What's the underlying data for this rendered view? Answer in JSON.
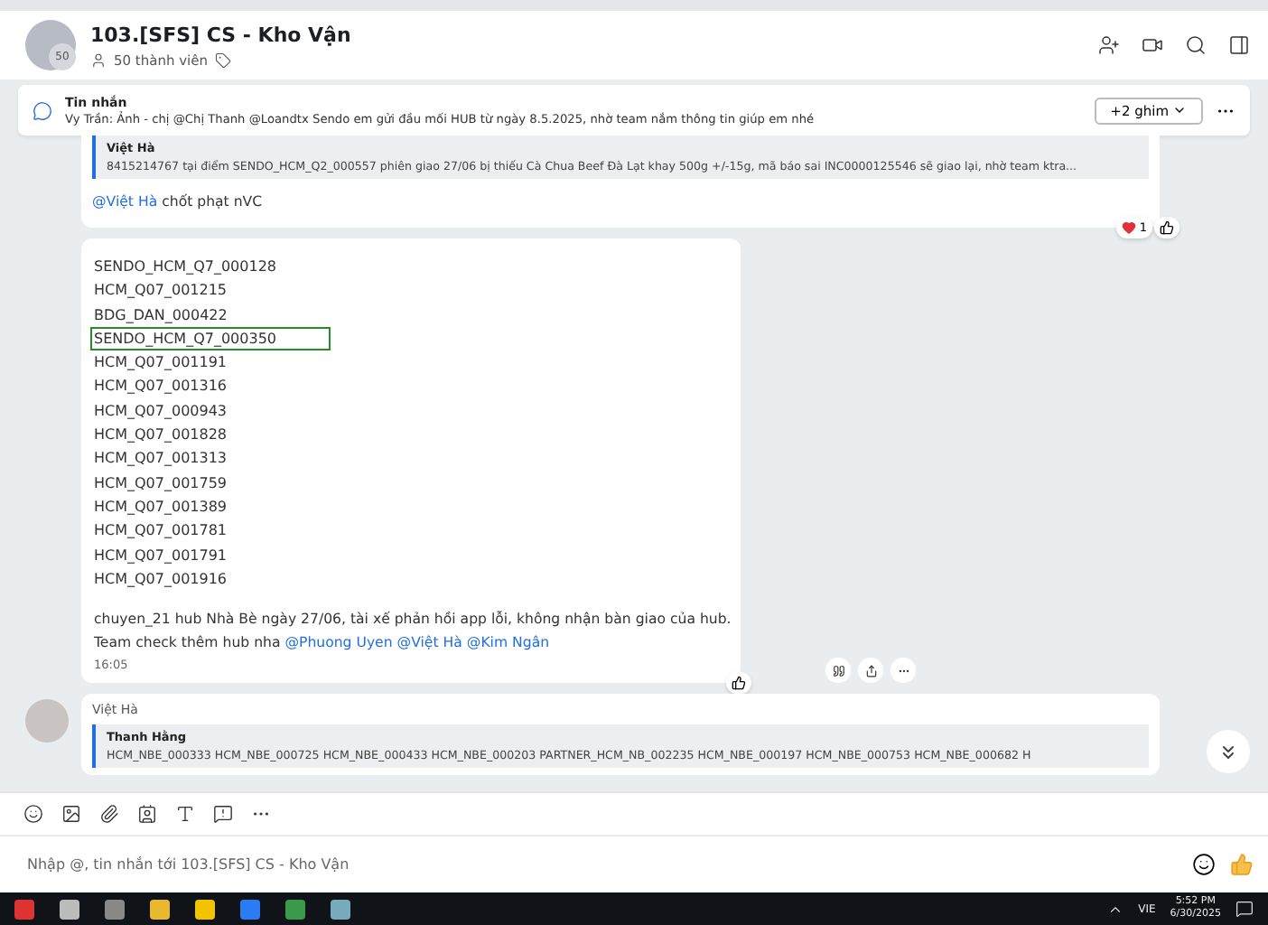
{
  "header": {
    "title": "103.[SFS] CS - Kho Vận",
    "members": "50 thành viên",
    "avatar_count": "50"
  },
  "pinned": {
    "label": "Tin nhắn",
    "sender": "Vy Trần:",
    "text": "Ảnh - chị @Chị Thanh @Loandtx Sendo em gửi đầu mối HUB từ ngày 8.5.2025, nhờ team nắm thông tin giúp em nhé",
    "pins_button": "+2 ghim"
  },
  "messages": [
    {
      "kind": "reply",
      "quote_author": "Việt Hà",
      "quote_text": "8415214767 tại điểm SENDO_HCM_Q2_000557 phiên giao 27/06 bị thiếu Cà Chua Beef Đà Lạt khay 500g +/-15g, mã báo sai INC0000125546 sẽ giao lại, nhờ team ktra...",
      "mention": "@Việt Hà",
      "text": "chốt phạt nVC",
      "reaction_count": "1"
    },
    {
      "kind": "list",
      "codes": [
        {
          "text": "SENDO_HCM_Q7_000128",
          "highlighted": false
        },
        {
          "text": "HCM_Q07_001215",
          "highlighted": false
        },
        {
          "text": "BDG_DAN_000422",
          "highlighted": false
        },
        {
          "text": "SENDO_HCM_Q7_000350",
          "highlighted": true
        },
        {
          "text": "HCM_Q07_001191",
          "highlighted": false
        },
        {
          "text": "HCM_Q07_001316",
          "highlighted": false
        },
        {
          "text": "HCM_Q07_000943",
          "highlighted": false
        },
        {
          "text": "HCM_Q07_001828",
          "highlighted": false
        },
        {
          "text": "HCM_Q07_001313",
          "highlighted": false
        },
        {
          "text": "HCM_Q07_001759",
          "highlighted": false
        },
        {
          "text": "HCM_Q07_001389",
          "highlighted": false
        },
        {
          "text": "HCM_Q07_001781",
          "highlighted": false
        },
        {
          "text": "HCM_Q07_001791",
          "highlighted": false
        },
        {
          "text": "HCM_Q07_001916",
          "highlighted": false
        }
      ],
      "line1": "chuyen_21 hub Nhà Bè ngày 27/06, tài xế phản hồi app lỗi, không nhận bàn giao của hub.",
      "line2": "Team check thêm hub nha",
      "mentions": [
        "@Phuong Uyen",
        "@Việt Hà",
        "@Kim Ngân"
      ],
      "time": "16:05"
    },
    {
      "kind": "incoming",
      "sender": "Việt Hà",
      "quote_author": "Thanh Hằng",
      "quote_text": "HCM_NBE_000333 HCM_NBE_000725 HCM_NBE_000433 HCM_NBE_000203 PARTNER_HCM_NB_002235 HCM_NBE_000197 HCM_NBE_000753 HCM_NBE_000682 H"
    }
  ],
  "composer": {
    "placeholder": "Nhập @, tin nhắn tới 103.[SFS] CS - Kho Vận"
  },
  "taskbar": {
    "language": "VIE",
    "time": "5:52 PM",
    "date": "6/30/2025"
  }
}
